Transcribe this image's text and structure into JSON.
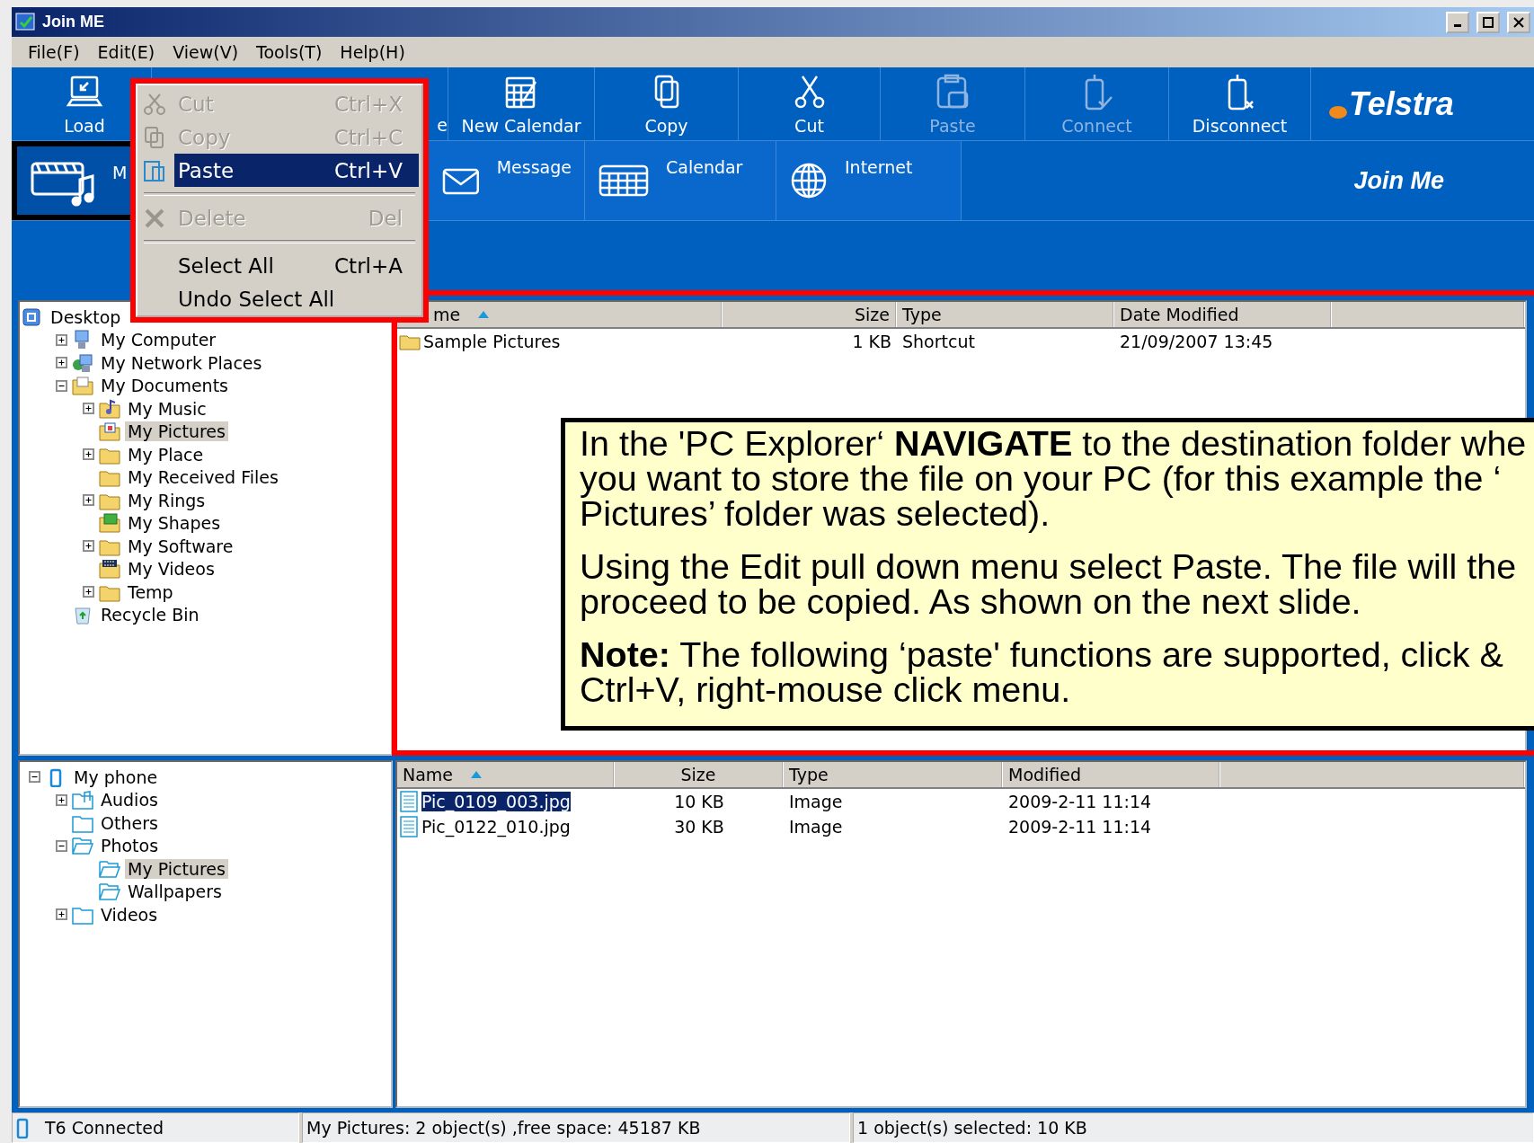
{
  "window": {
    "title": "Join ME"
  },
  "menubar": [
    "File(F)",
    "Edit(E)",
    "View(V)",
    "Tools(T)",
    "Help(H)"
  ],
  "toolbar_top": [
    {
      "label": "Load",
      "kind": "load",
      "disabled": false
    },
    {
      "label": "e",
      "kind": "none",
      "disabled": false
    },
    {
      "label": "New Calendar",
      "kind": "new-calendar",
      "disabled": false
    },
    {
      "label": "Copy",
      "kind": "copy",
      "disabled": false
    },
    {
      "label": "Cut",
      "kind": "cut",
      "disabled": false
    },
    {
      "label": "Paste",
      "kind": "paste",
      "disabled": true
    },
    {
      "label": "Connect",
      "kind": "connect",
      "disabled": true
    },
    {
      "label": "Disconnect",
      "kind": "disconnect",
      "disabled": false
    }
  ],
  "logo": {
    "brand": "Telstra",
    "product": "Join Me"
  },
  "toolbar_bottom": [
    {
      "label": "M",
      "kind": "media",
      "selected": true
    },
    {
      "label": "Message",
      "kind": "message",
      "selected": false
    },
    {
      "label": "Calendar",
      "kind": "calendar",
      "selected": false
    },
    {
      "label": "Internet",
      "kind": "internet",
      "selected": false
    }
  ],
  "edit_menu": [
    {
      "kind": "cut",
      "label": "Cut",
      "shortcut": "Ctrl+X",
      "disabled": true,
      "selected": false
    },
    {
      "kind": "copy",
      "label": "Copy",
      "shortcut": "Ctrl+C",
      "disabled": true,
      "selected": false
    },
    {
      "kind": "paste",
      "label": "Paste",
      "shortcut": "Ctrl+V",
      "disabled": false,
      "selected": true
    },
    {
      "kind": "separator"
    },
    {
      "kind": "delete",
      "label": "Delete",
      "shortcut": "Del",
      "disabled": true,
      "selected": false
    },
    {
      "kind": "separator"
    },
    {
      "kind": "plain",
      "label": "Select All",
      "shortcut": "Ctrl+A",
      "disabled": false,
      "selected": false
    },
    {
      "kind": "plain",
      "label": "Undo Select All",
      "disabled": false,
      "selected": false
    }
  ],
  "pc_tree": [
    {
      "label": "Desktop",
      "kind": "desktop",
      "selected": false,
      "children": [
        {
          "label": "My Computer",
          "kind": "computer",
          "expanded": false,
          "selected": false
        },
        {
          "label": "My Network Places",
          "kind": "network",
          "expanded": false,
          "selected": false
        },
        {
          "label": "My Documents",
          "kind": "documents",
          "expanded": true,
          "selected": false,
          "children": [
            {
              "label": "My Music",
              "kind": "music",
              "expanded": false,
              "selected": false
            },
            {
              "label": "My Pictures",
              "kind": "pictures",
              "selected": true
            },
            {
              "label": "My Place",
              "kind": "folder",
              "expanded": false,
              "selected": false
            },
            {
              "label": "My Received Files",
              "kind": "folder",
              "selected": false
            },
            {
              "label": "My Rings",
              "kind": "folder",
              "expanded": false,
              "selected": false
            },
            {
              "label": "My Shapes",
              "kind": "shapes",
              "selected": false
            },
            {
              "label": "My Software",
              "kind": "folder",
              "expanded": false,
              "selected": false
            },
            {
              "label": "My Videos",
              "kind": "videos",
              "selected": false
            },
            {
              "label": "Temp",
              "kind": "folder",
              "expanded": false,
              "selected": false
            }
          ]
        },
        {
          "label": "Recycle Bin",
          "kind": "recycle",
          "selected": false
        }
      ]
    }
  ],
  "pc_list": {
    "columns": [
      {
        "label": "me",
        "sorted": true
      },
      {
        "label": "Size",
        "sorted": false
      },
      {
        "label": "Type",
        "sorted": false
      },
      {
        "label": "Date Modified",
        "sorted": false
      }
    ],
    "rows": [
      {
        "kind": "folder",
        "selected": false,
        "cells": [
          "Sample Pictures",
          "1 KB",
          "Shortcut",
          "21/09/2007 13:45"
        ]
      }
    ]
  },
  "phone_tree": [
    {
      "label": "My phone",
      "kind": "phone",
      "expanded": true,
      "selected": false,
      "children": [
        {
          "label": "Audios",
          "kind": "audio",
          "expanded": false,
          "selected": false
        },
        {
          "label": "Others",
          "kind": "outline",
          "selected": false
        },
        {
          "label": "Photos",
          "kind": "open",
          "expanded": true,
          "selected": false,
          "children": [
            {
              "label": "My Pictures",
              "kind": "open",
              "selected": true
            },
            {
              "label": "Wallpapers",
              "kind": "open",
              "selected": false
            }
          ]
        },
        {
          "label": "Videos",
          "kind": "outline",
          "expanded": false,
          "selected": false
        }
      ]
    }
  ],
  "phone_list": {
    "columns": [
      {
        "label": "Name",
        "sorted": true
      },
      {
        "label": "Size",
        "sorted": false
      },
      {
        "label": "Type",
        "sorted": false
      },
      {
        "label": "Modified",
        "sorted": false
      }
    ],
    "rows": [
      {
        "kind": "file",
        "selected": true,
        "cells": [
          "Pic_0109_003.jpg",
          "10 KB",
          "Image",
          "2009-2-11 11:14"
        ]
      },
      {
        "kind": "file",
        "selected": false,
        "cells": [
          "Pic_0122_010.jpg",
          "30 KB",
          "Image",
          "2009-2-11 11:14"
        ]
      }
    ]
  },
  "status_bar": [
    {
      "text": "T6 Connected",
      "kind": "phone"
    },
    {
      "text": "My Pictures: 2 object(s) ,free space: 45187 KB",
      "kind": "none"
    },
    {
      "text": "1 object(s) selected: 10 KB",
      "kind": "none"
    }
  ],
  "callout": [
    {
      "lines": [
        "In the 'PC Explorer‘ **NAVIGATE** to the destination folder whe",
        "you want to store the file on your PC (for this example the ‘",
        "Pictures’ folder was selected)."
      ]
    },
    {
      "lines": [
        "Using the Edit pull down menu select Paste. The file will the",
        "proceed to be copied. As shown on the next slide."
      ]
    },
    {
      "lines": [
        "**Note:** The following ‘paste' functions are supported, click &",
        "Ctrl+V, right-mouse click menu."
      ]
    }
  ]
}
